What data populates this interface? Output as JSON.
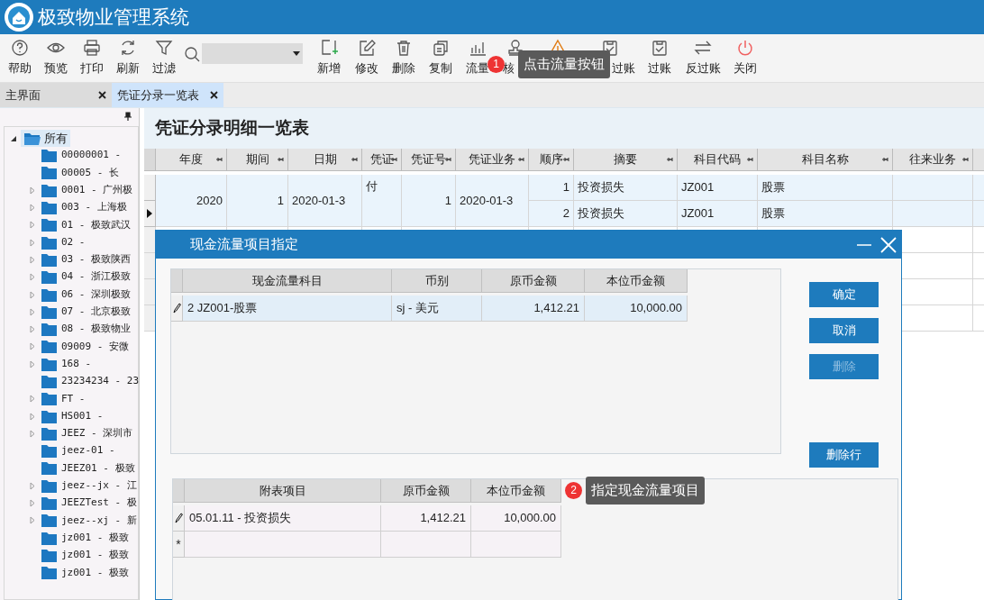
{
  "app": {
    "title": "极致物业管理系统"
  },
  "toolbar": {
    "items": [
      {
        "label": "帮助"
      },
      {
        "label": "预览"
      },
      {
        "label": "打印"
      },
      {
        "label": "刷新"
      },
      {
        "label": "过滤"
      }
    ],
    "actions": [
      {
        "label": "新增"
      },
      {
        "label": "修改"
      },
      {
        "label": "删除"
      },
      {
        "label": "复制"
      },
      {
        "label": "流量"
      },
      {
        "label": "核"
      },
      {
        "kind": "warning"
      },
      {
        "label": "过账"
      },
      {
        "label": "过账"
      },
      {
        "label": "反过账"
      },
      {
        "label": "关闭"
      }
    ]
  },
  "tabs": [
    {
      "label": "主界面",
      "selected": false
    },
    {
      "label": "凭证分录一览表",
      "selected": true
    }
  ],
  "sidebar": {
    "tree": [
      {
        "label": "所有",
        "expanded": true,
        "selected": true,
        "children": [
          {
            "label": "00000001 -",
            "has_children": false
          },
          {
            "label": "00005 - 长",
            "has_children": false
          },
          {
            "label": "0001 - 广州极",
            "has_children": true
          },
          {
            "label": "003 - 上海极",
            "has_children": true
          },
          {
            "label": "01 - 极致武汉",
            "has_children": true
          },
          {
            "label": "02 -",
            "has_children": true
          },
          {
            "label": "03 - 极致陕西",
            "has_children": true
          },
          {
            "label": "04 - 浙江极致",
            "has_children": true
          },
          {
            "label": "06 - 深圳极致",
            "has_children": true
          },
          {
            "label": "07 - 北京极致",
            "has_children": true
          },
          {
            "label": "08 - 极致物业",
            "has_children": true
          },
          {
            "label": "09009 - 安微",
            "has_children": true
          },
          {
            "label": "168 -",
            "has_children": true
          },
          {
            "label": "23234234 - 23",
            "has_children": false
          },
          {
            "label": "FT -",
            "has_children": true
          },
          {
            "label": "HS001 -",
            "has_children": true
          },
          {
            "label": "JEEZ - 深圳市",
            "has_children": true
          },
          {
            "label": "jeez-01 -",
            "has_children": false
          },
          {
            "label": "JEEZ01 - 极致",
            "has_children": false
          },
          {
            "label": "jeez--jx - 江",
            "has_children": true
          },
          {
            "label": "JEEZTest - 极",
            "has_children": true
          },
          {
            "label": "jeez--xj - 新",
            "has_children": true
          },
          {
            "label": "jz001 - 极致",
            "has_children": false
          },
          {
            "label": "jz001 - 极致",
            "has_children": false
          },
          {
            "label": "jz001 - 极致",
            "has_children": false
          }
        ]
      }
    ]
  },
  "page": {
    "heading": "凭证分录明细一览表",
    "table": {
      "columns": [
        "年度",
        "期间",
        "日期",
        "凭证",
        "凭证号",
        "凭证业务",
        "顺序",
        "摘要",
        "科目代码",
        "科目名称",
        "往来业务"
      ],
      "groups": [
        {
          "year": "2020",
          "period": "1",
          "date": "2020-01-3",
          "voucher": "付",
          "voucher_no": "1",
          "voucher_business": "2020-01-3",
          "lines": [
            {
              "seq": "1",
              "summary": "投资损失",
              "code": "JZ001",
              "name": "股票",
              "current": false
            },
            {
              "seq": "2",
              "summary": "投资损失",
              "code": "JZ001",
              "name": "股票",
              "current": true
            }
          ]
        }
      ]
    }
  },
  "dialog": {
    "title": "现金流量项目指定",
    "items_grid": {
      "columns": [
        "现金流量科目",
        "币别",
        "原币金额",
        "本位币金额"
      ],
      "rows": [
        {
          "cells": [
            "2 JZ001-股票",
            "sj - 美元",
            "1,412.21",
            "10,000.00"
          ],
          "editing": true
        }
      ]
    },
    "buttons": [
      {
        "label": "确定",
        "disabled": false
      },
      {
        "label": "取消",
        "disabled": false
      },
      {
        "label": "删除",
        "disabled": true
      }
    ],
    "delete_row_button": {
      "label": "删除行"
    },
    "schedule_grid": {
      "columns": [
        "附表项目",
        "原币金额",
        "本位币金额"
      ],
      "rows": [
        {
          "cells": [
            "05.01.11 - 投资损失",
            "1,412.21",
            "10,000.00"
          ],
          "editing": true
        }
      ],
      "new_row_marker": "*"
    }
  },
  "callouts": [
    {
      "number": "1",
      "text": "点击流量按钮"
    },
    {
      "number": "2",
      "text": "指定现金流量项目"
    }
  ]
}
